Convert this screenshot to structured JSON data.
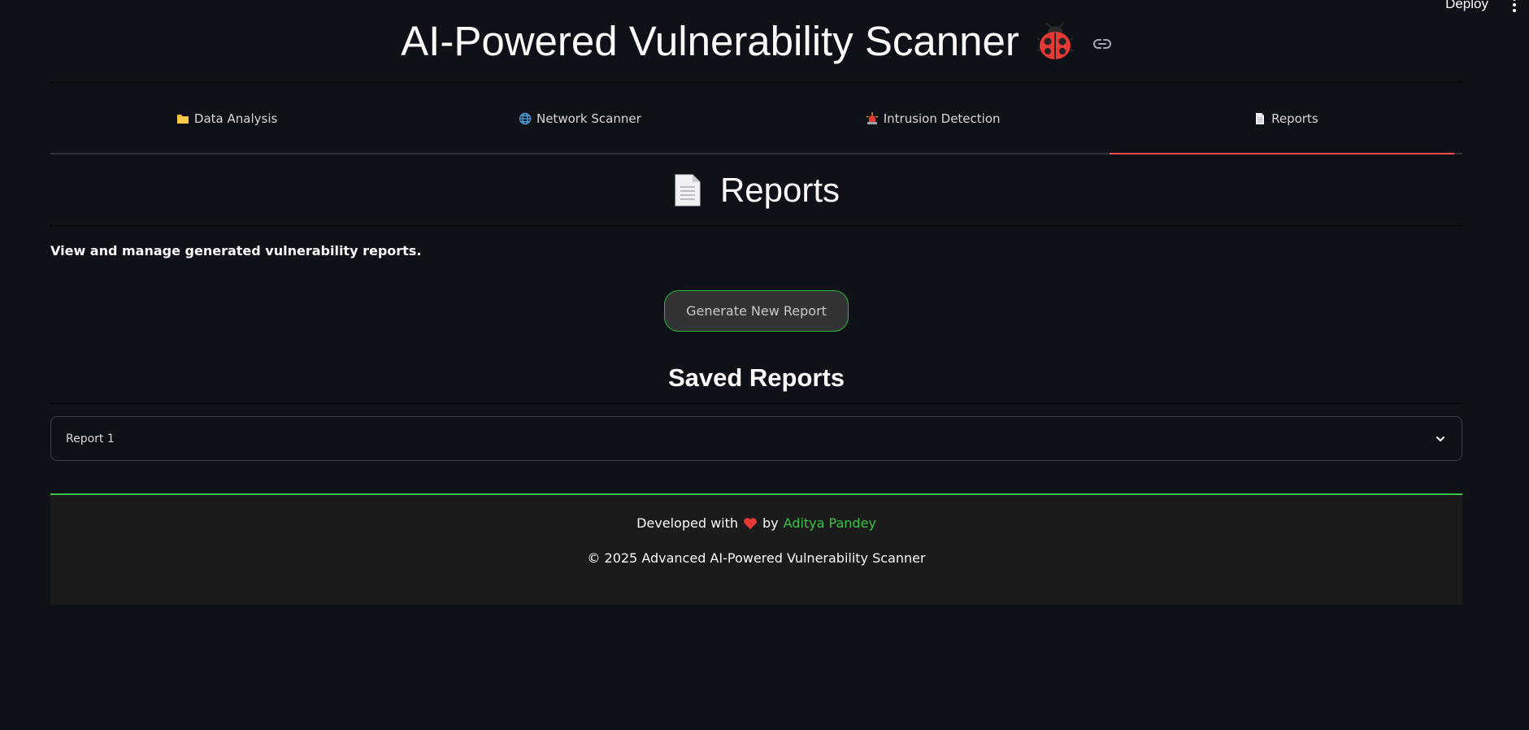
{
  "topbar": {
    "deploy_label": "Deploy"
  },
  "header": {
    "title": "AI-Powered Vulnerability Scanner",
    "title_icon": "ladybug-icon"
  },
  "tabs": [
    {
      "label": "Data Analysis",
      "icon": "folder-icon"
    },
    {
      "label": "Network Scanner",
      "icon": "globe-icon"
    },
    {
      "label": "Intrusion Detection",
      "icon": "siren-icon"
    },
    {
      "label": "Reports",
      "icon": "document-icon",
      "active": true
    }
  ],
  "reports": {
    "title": "Reports",
    "description": "View and manage generated vulnerability reports.",
    "generate_button": "Generate New Report",
    "saved_title": "Saved Reports",
    "items": [
      {
        "label": "Report 1"
      }
    ]
  },
  "footer": {
    "developed_with": "Developed with",
    "by": "by",
    "author": "Aditya Pandey",
    "copyright": "© 2025 Advanced AI-Powered Vulnerability Scanner"
  },
  "colors": {
    "background": "#0e1117",
    "accent_red": "#ff4b4b",
    "accent_green": "#3cc14a",
    "footer_bg": "#1b1b1b"
  }
}
